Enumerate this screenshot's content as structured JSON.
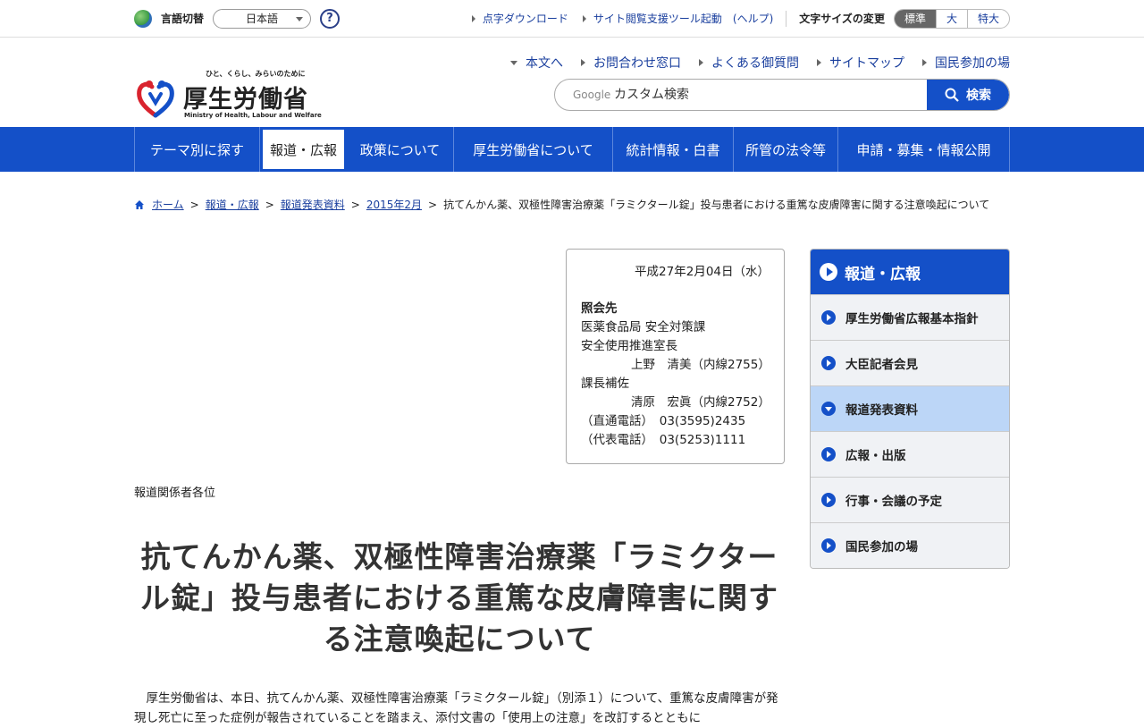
{
  "topbar": {
    "lang_label": "言語切替",
    "lang_value": "日本語",
    "help": "?",
    "links": [
      "点字ダウンロード",
      "サイト閲覧支援ツール起動　(ヘルプ)"
    ],
    "fontsize_label": "文字サイズの変更",
    "fontsizes": [
      "標準",
      "大",
      "特大"
    ]
  },
  "logo": {
    "tagline": "ひと、くらし、みらいのために",
    "name": "厚生労働省",
    "english": "Ministry of Health, Labour and Welfare"
  },
  "header_links": [
    "本文へ",
    "お問合わせ窓口",
    "よくある御質問",
    "サイトマップ",
    "国民参加の場"
  ],
  "search": {
    "google": "Google",
    "placeholder": "カスタム検索",
    "button": "検索"
  },
  "gnav": [
    "テーマ別に探す",
    "報道・広報",
    "政策について",
    "厚生労働省について",
    "統計情報・白書",
    "所管の法令等",
    "申請・募集・情報公開"
  ],
  "breadcrumb": {
    "items": [
      "ホーム",
      "報道・広報",
      "報道発表資料",
      "2015年2月"
    ],
    "current": "抗てんかん薬、双極性障害治療薬「ラミクタール錠」投与患者における重篤な皮膚障害に関する注意喚起について"
  },
  "contact": {
    "date": "平成27年2月04日（水）",
    "heading": "照会先",
    "lines": [
      "医薬食品局 安全対策課",
      "安全使用推進室長"
    ],
    "person1": "上野　清美（内線2755）",
    "role2": "課長補佐",
    "person2": "清原　宏眞（内線2752）",
    "tel_direct": "（直通電話）　03(3595)2435",
    "tel_main": "（代表電話）　03(5253)1111"
  },
  "addressee": "報道関係者各位",
  "title": "抗てんかん薬、双極性障害治療薬「ラミクタール錠」投与患者における重篤な皮膚障害に関する注意喚起について",
  "body": "厚生労働省は、本日、抗てんかん薬、双極性障害治療薬「ラミクタール錠」（別添１）について、重篤な皮膚障害が発現し死亡に至った症例が報告されていることを踏まえ、添付文書の「使用上の注意」を改訂するとともに",
  "sidebar": {
    "heading": "報道・広報",
    "items": [
      "厚生労働省広報基本指針",
      "大臣記者会見",
      "報道発表資料",
      "広報・出版",
      "行事・会議の予定",
      "国民参加の場"
    ]
  }
}
